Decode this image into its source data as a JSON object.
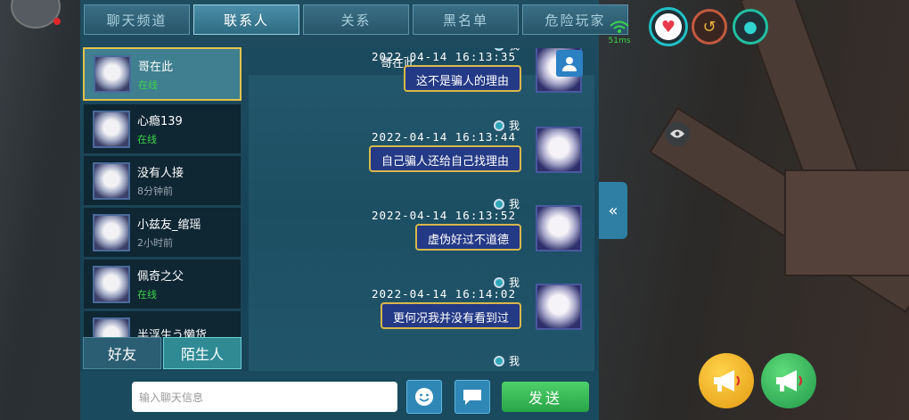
{
  "top_tabs": [
    {
      "label": "聊天频道",
      "active": false
    },
    {
      "label": "联系人",
      "active": true
    },
    {
      "label": "关系",
      "active": false
    },
    {
      "label": "黑名单",
      "active": false
    },
    {
      "label": "危险玩家",
      "active": false
    }
  ],
  "contacts": [
    {
      "name": "哥在此",
      "status": "在线",
      "online": true,
      "selected": true
    },
    {
      "name": "心瘾139",
      "status": "在线",
      "online": true,
      "selected": false
    },
    {
      "name": "没有人接",
      "status": "8分钟前",
      "online": false,
      "selected": false
    },
    {
      "name": "小兹友_绾瑶",
      "status": "2小时前",
      "online": false,
      "selected": false
    },
    {
      "name": "佩奇之父",
      "status": "在线",
      "online": true,
      "selected": false
    },
    {
      "name": "半浮生う懒货",
      "status": "",
      "online": false,
      "selected": false
    }
  ],
  "bottom_tabs": {
    "friends": "好友",
    "strangers": "陌生人"
  },
  "chat": {
    "title": "哥在此",
    "messages": [
      {
        "sender": "我",
        "time": "2022-04-14  16:13:35",
        "text": "这不是骗人的理由"
      },
      {
        "sender": "我",
        "time": "2022-04-14  16:13:44",
        "text": "自己骗人还给自己找理由"
      },
      {
        "sender": "我",
        "time": "2022-04-14  16:13:52",
        "text": "虚伪好过不道德"
      },
      {
        "sender": "我",
        "time": "2022-04-14  16:14:02",
        "text": "更何况我并没有看到过"
      },
      {
        "sender": "我",
        "time": "",
        "text": ""
      }
    ]
  },
  "input": {
    "placeholder": "输入聊天信息"
  },
  "send_label": "发送",
  "ping": "51ms",
  "icons": {
    "emoji": "emoji-icon",
    "chat_bubble": "chat-bubble-icon",
    "collapse": "double-chevron-left-icon",
    "eye": "eye-icon",
    "heart": "heart-icon",
    "water": "water-drop-icon",
    "megaphone": "megaphone-icon"
  },
  "colors": {
    "online": "#3bd64a",
    "send": "#2fa84a",
    "selected_border": "#e4c24a"
  }
}
